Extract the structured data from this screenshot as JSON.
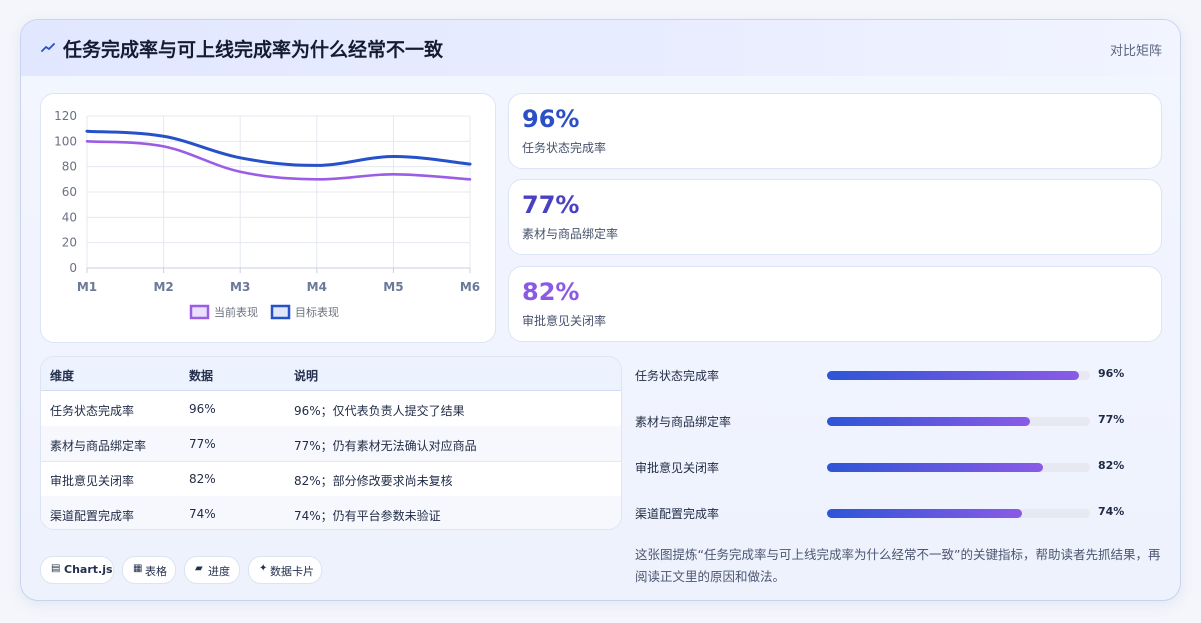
{
  "header": {
    "title": "任务完成率与可上线完成率为什么经常不一致",
    "link_label": "对比矩阵"
  },
  "chart_data": {
    "type": "line",
    "categories": [
      "M1",
      "M2",
      "M3",
      "M4",
      "M5",
      "M6"
    ],
    "series": [
      {
        "name": "当前表现",
        "values": [
          100,
          96,
          76,
          70,
          74,
          70
        ],
        "color": "#9b5de5"
      },
      {
        "name": "目标表现",
        "values": [
          108,
          104,
          87,
          81,
          88,
          82
        ],
        "color": "#2751c9"
      }
    ],
    "ylim": [
      0,
      120
    ],
    "yticks": [
      0,
      20,
      40,
      60,
      80,
      100,
      120
    ],
    "grid": true,
    "legend": "bottom",
    "title": "",
    "xlabel": "",
    "ylabel": ""
  },
  "stats": [
    {
      "value": "96%",
      "label": "任务状态完成率",
      "color": "#2c4fc9"
    },
    {
      "value": "77%",
      "label": "素材与商品绑定率",
      "color": "#4a40c4"
    },
    {
      "value": "82%",
      "label": "审批意见关闭率",
      "color": "#8a5ae6"
    }
  ],
  "table": {
    "headers": [
      "维度",
      "数据",
      "说明"
    ],
    "rows": [
      [
        "任务状态完成率",
        "96%",
        "96%；仅代表负责人提交了结果"
      ],
      [
        "素材与商品绑定率",
        "77%",
        "77%；仍有素材无法确认对应商品"
      ],
      [
        "审批意见关闭率",
        "82%",
        "82%；部分修改要求尚未复核"
      ],
      [
        "渠道配置完成率",
        "74%",
        "74%；仍有平台参数未验证"
      ]
    ]
  },
  "progress": [
    {
      "label": "任务状态完成率",
      "value": 96,
      "value_text": "96%"
    },
    {
      "label": "素材与商品绑定率",
      "value": 77,
      "value_text": "77%"
    },
    {
      "label": "审批意见关闭率",
      "value": 82,
      "value_text": "82%"
    },
    {
      "label": "渠道配置完成率",
      "value": 74,
      "value_text": "74%"
    }
  ],
  "chips": [
    {
      "icon": "chart-icon",
      "glyph": "▤",
      "label": "Chart.js"
    },
    {
      "icon": "table-icon",
      "glyph": "▦",
      "label": "表格"
    },
    {
      "icon": "progress-icon",
      "glyph": "▰",
      "label": "进度"
    },
    {
      "icon": "sparkle-icon",
      "glyph": "✦",
      "label": "数据卡片"
    }
  ],
  "summary": "这张图提炼“任务完成率与可上线完成率为什么经常不一致”的关键指标，帮助读者先抓结果，再阅读正文里的原因和做法。"
}
